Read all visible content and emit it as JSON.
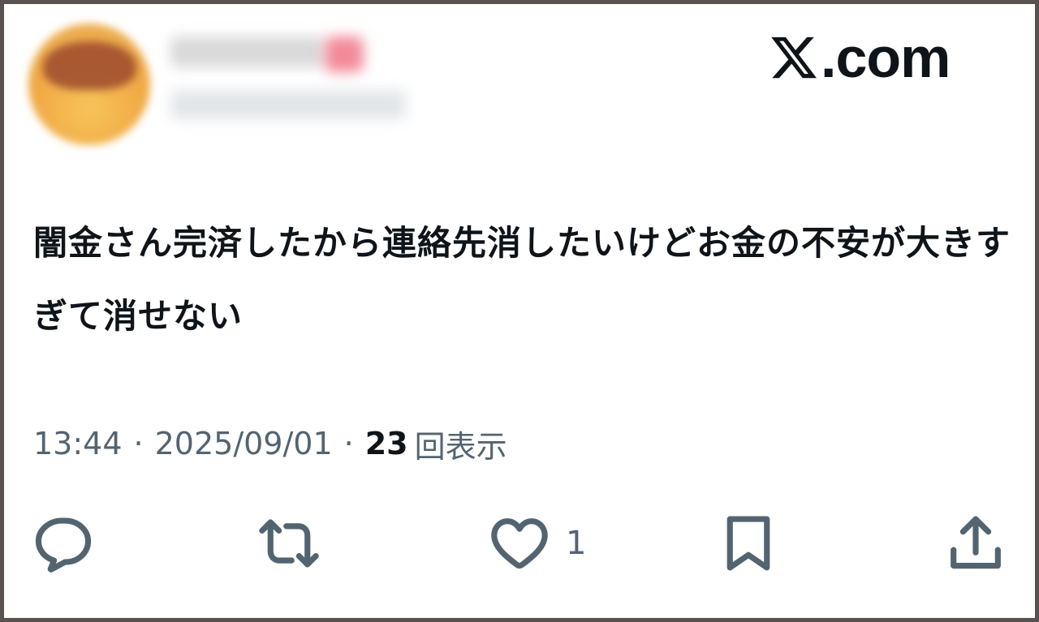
{
  "brand": {
    "domain_label": ".com",
    "logo_icon": "x-logo-icon"
  },
  "author": {
    "avatar_icon": "avatar-image"
  },
  "tweet": {
    "text": "闇金さん完済したから連絡先消したいけどお金の不安が大きすぎて消せない",
    "time": "13:44",
    "separator": "·",
    "date": "2025/09/01",
    "views_count": "23",
    "views_label": "回表示"
  },
  "actions": {
    "reply": {
      "icon": "reply-icon",
      "count": ""
    },
    "retweet": {
      "icon": "retweet-icon",
      "count": ""
    },
    "like": {
      "icon": "heart-icon",
      "count": "1"
    },
    "bookmark": {
      "icon": "bookmark-icon",
      "count": ""
    },
    "share": {
      "icon": "share-icon",
      "count": ""
    }
  },
  "colors": {
    "text": "#0f1419",
    "secondary": "#536471",
    "frame": "#5a5250",
    "background": "#ffffff"
  }
}
